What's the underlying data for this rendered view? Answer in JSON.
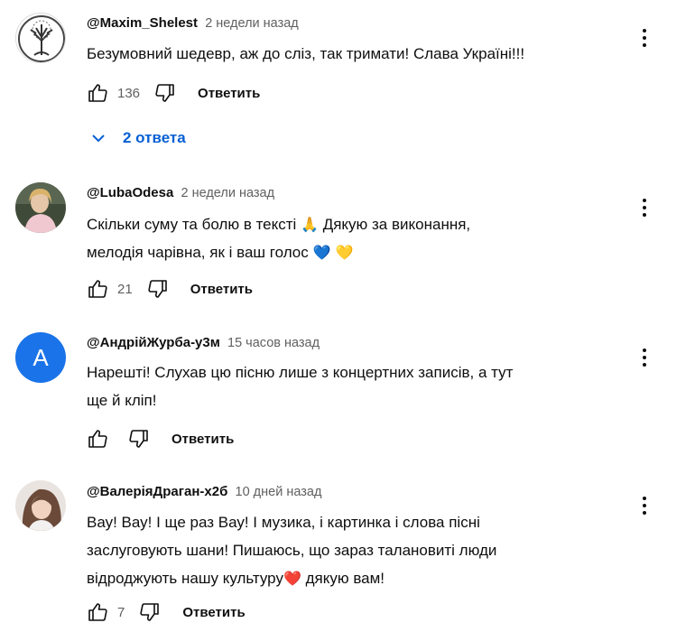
{
  "comments": [
    {
      "author": "@Maxim_Shelest",
      "time": "2 недели назад",
      "lines": [
        "Безумовний шедевр, аж до сліз, так тримати!  Слава Україні!!!"
      ],
      "likes": "136",
      "reply_label": "Ответить",
      "avatar_icon": "tree-logo-avatar"
    },
    {
      "author": "@LubaOdesa",
      "time": "2 недели назад",
      "line1": "Скільки суму та болю в тексті ",
      "line1_emoji": "🙏",
      "line1_end": " Дякую за виконання,",
      "line2": "мелодія чарівна, як і ваш голос ",
      "line2_emoji": "💙 💛",
      "likes": "21",
      "reply_label": "Ответить"
    },
    {
      "author": "@АндрійЖурба-у3м",
      "time": "15 часов назад",
      "lines": [
        "Нарешті! Слухав цю пісню лише з концертних записів, а тут",
        "ще й кліп!"
      ],
      "likes": "",
      "reply_label": "Ответить",
      "avatar_letter": "A",
      "avatar_color": "#1a73e8"
    },
    {
      "author": "@ВалеріяДраган-х2б",
      "time": "10 дней назад",
      "line1": "Вау! Вау!  І ще раз Вау! І музика, і картинка і слова пісні",
      "line2": "заслуговують шани! Пишаюсь, що зараз талановиті люди",
      "line3": "відроджують нашу культуру",
      "line3_emoji": "❤️",
      "line3_end": "  дякую вам!",
      "likes": "7",
      "reply_label": "Ответить"
    }
  ],
  "replies_toggle": {
    "label": "2 ответа",
    "icon": "chevron-down-icon",
    "color": "#065fd4"
  }
}
